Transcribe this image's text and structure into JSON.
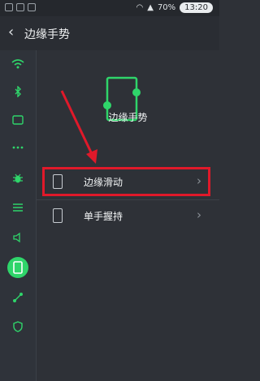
{
  "statusbar": {
    "battery": "70%",
    "time": "13:20"
  },
  "header": {
    "back_icon": "chevron-left-icon",
    "title": "边缘手势"
  },
  "sidebar": {
    "items": [
      {
        "icon": "wifi-icon"
      },
      {
        "icon": "bluetooth-icon"
      },
      {
        "icon": "tablet-icon"
      },
      {
        "icon": "more-dots-icon"
      },
      {
        "icon": "bug-icon"
      },
      {
        "icon": "list-icon"
      },
      {
        "icon": "volume-icon"
      },
      {
        "icon": "edge-gesture-icon",
        "active": true
      },
      {
        "icon": "share-icon"
      },
      {
        "icon": "shield-icon"
      }
    ]
  },
  "main": {
    "gesture_label": "边缘手势",
    "items": [
      {
        "label": "边缘滑动",
        "icon": "phone-edge-icon",
        "highlighted": true
      },
      {
        "label": "单手握持",
        "icon": "phone-hold-icon",
        "highlighted": false
      }
    ]
  },
  "colors": {
    "accent": "#2fd56a",
    "highlight": "#e0192a",
    "background": "#2e3137"
  }
}
